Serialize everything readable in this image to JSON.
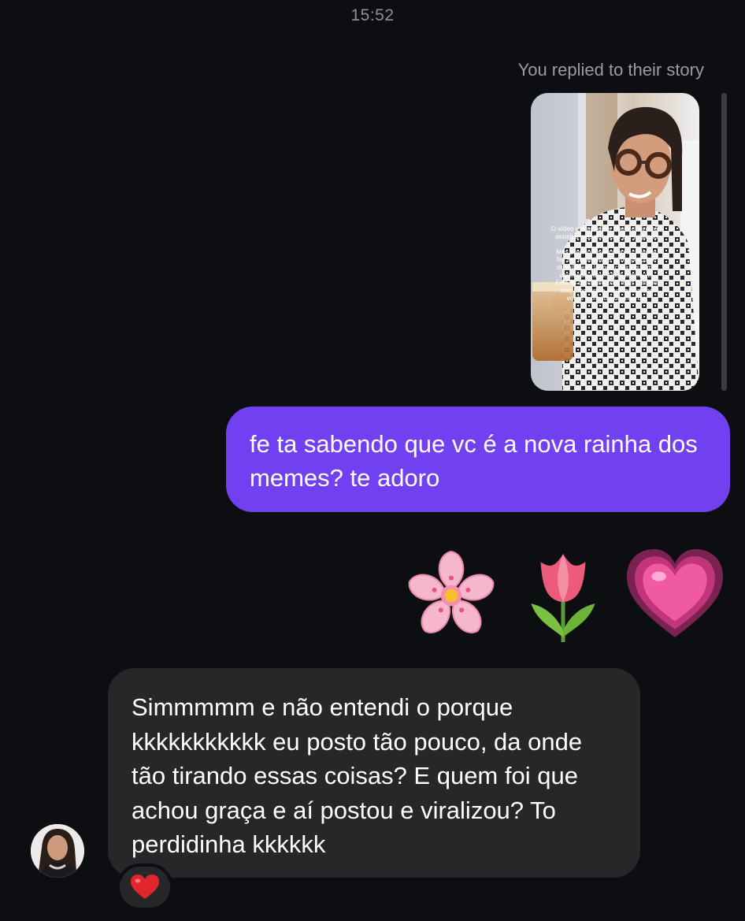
{
  "timestamp": "15:52",
  "story_reply": {
    "label": "You replied to their story",
    "overlay_lines": [
      "O vídeo era pra dizer que o cheiro não",
      "assistou mas não ficou pré julgando",
      "",
      "Mas preciso frisar como o cheiro te",
      "faz ser imperfeito e tem o preço de",
      "de milhões - lá meu cheiro que me",
      "descansou dele. Você tem muito",
      "Fala as do cheiro com mais carinho",
      "mas amo isso a nova rainha dos",
      "vocês o produto do meu dia"
    ]
  },
  "sent_message": {
    "text": "fe ta sabendo que vc é a nova rainha dos memes? te adoro",
    "color": "#7141f1"
  },
  "emoji_message": {
    "emojis": [
      "cherry-blossom-icon",
      "tulip-icon",
      "growing-heart-icon"
    ]
  },
  "received_message": {
    "text": "Simmmmm e não entendi o porque kkkkkkkkkkk eu posto tão pouco, da onde tão tirando essas coisas? E quem foi que achou graça e aí postou e viralizou? To perdidinha kkkkkk",
    "color": "#262729"
  },
  "reaction": {
    "icon": "red-heart-icon",
    "color": "#e0262c"
  },
  "colors": {
    "background": "#0c0e12",
    "muted_text": "#8d8f96"
  }
}
